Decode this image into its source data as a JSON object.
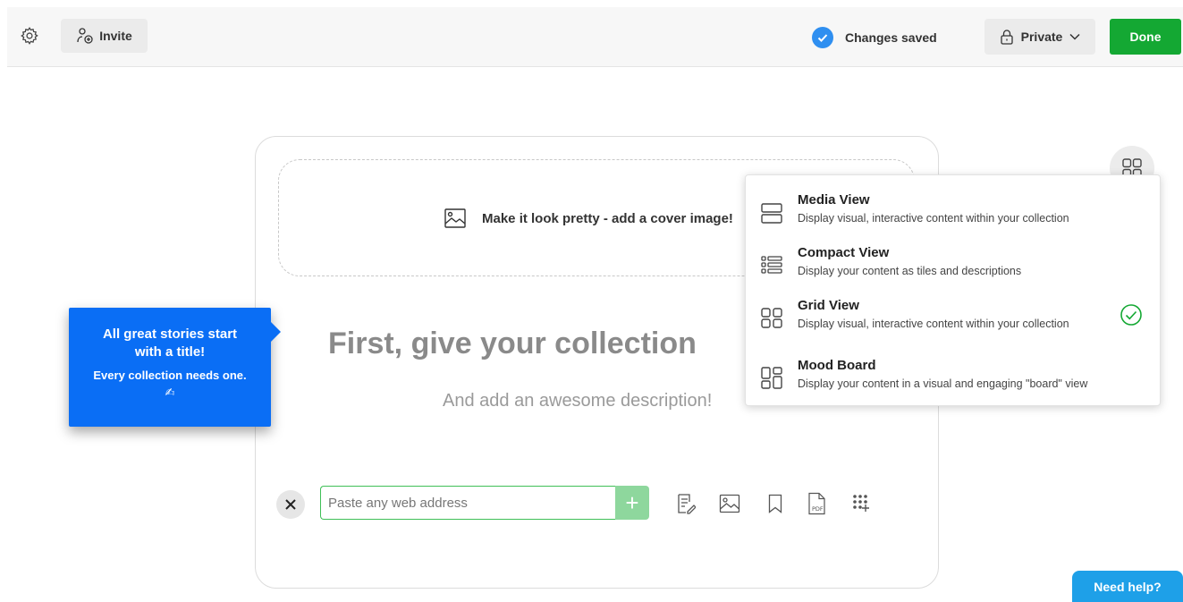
{
  "topbar": {
    "invite_label": "Invite",
    "saved_label": "Changes saved",
    "privacy_label": "Private",
    "done_label": "Done"
  },
  "editor": {
    "cover_label": "Make it look pretty - add a cover image!",
    "title_placeholder": "First, give your collection",
    "description_placeholder": "And add an awesome description!",
    "url_placeholder": "Paste any web address",
    "add_symbol": "+"
  },
  "tooltip": {
    "title": "All great stories start with a title!",
    "subtitle": "Every collection needs one. ✍"
  },
  "view_menu": {
    "items": [
      {
        "title": "Media View",
        "description": "Display visual, interactive content within your collection",
        "icon": "media-view-icon",
        "selected": false
      },
      {
        "title": "Compact View",
        "description": "Display your content as tiles and descriptions",
        "icon": "compact-view-icon",
        "selected": false
      },
      {
        "title": "Grid View",
        "description": "Display visual, interactive content within your collection",
        "icon": "grid-view-icon",
        "selected": true
      },
      {
        "title": "Mood Board",
        "description": "Display your content in a visual and engaging \"board\" view",
        "icon": "mood-board-icon",
        "selected": false
      }
    ]
  },
  "help": {
    "label": "Need help?"
  },
  "colors": {
    "done": "#14a833",
    "tooltip": "#0a6ef5",
    "saved_check": "#2f8ff0",
    "help": "#1ea0e8",
    "selected_check": "#14a833"
  }
}
